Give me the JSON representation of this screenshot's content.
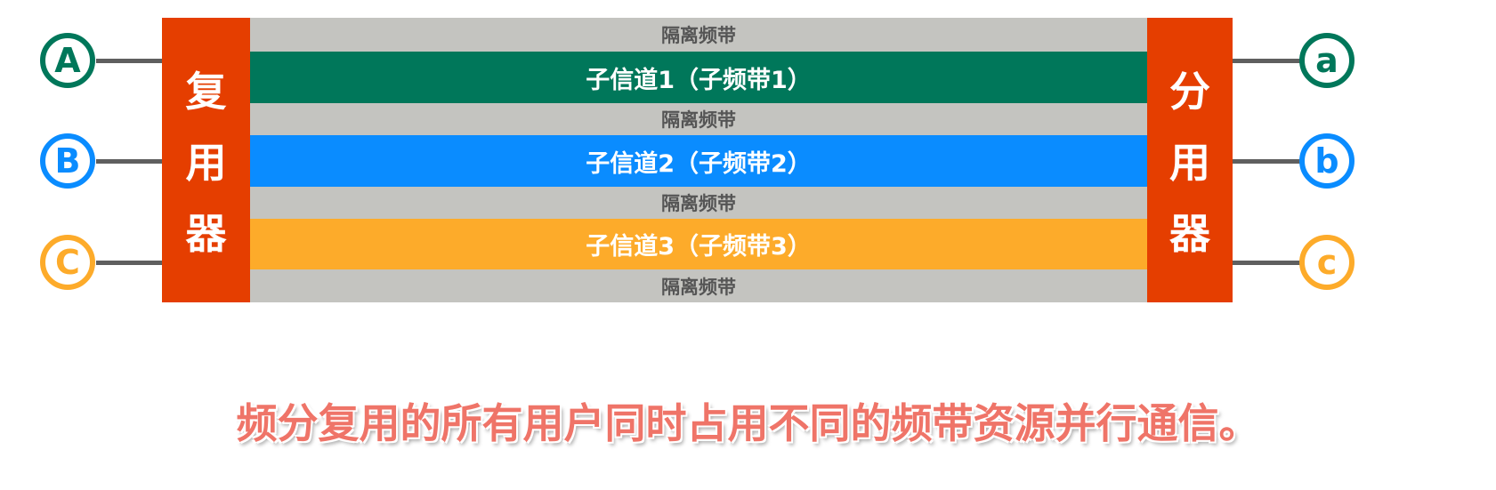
{
  "inputs": [
    {
      "label": "A",
      "color": "#00775a"
    },
    {
      "label": "B",
      "color": "#0a8cff"
    },
    {
      "label": "C",
      "color": "#fdab2a"
    }
  ],
  "outputs": [
    {
      "label": "a",
      "color": "#00775a"
    },
    {
      "label": "b",
      "color": "#0a8cff"
    },
    {
      "label": "c",
      "color": "#fdab2a"
    }
  ],
  "multiplexer": [
    "复",
    "用",
    "器"
  ],
  "demultiplexer": [
    "分",
    "用",
    "器"
  ],
  "guard_band": "隔离频带",
  "channels": [
    {
      "label": "子信道1（子频带1）",
      "color": "#00775a"
    },
    {
      "label": "子信道2（子频带2）",
      "color": "#0a8cff"
    },
    {
      "label": "子信道3（子频带3）",
      "color": "#fdab2a"
    }
  ],
  "caption": "频分复用的所有用户同时占用不同的频带资源并行通信。"
}
